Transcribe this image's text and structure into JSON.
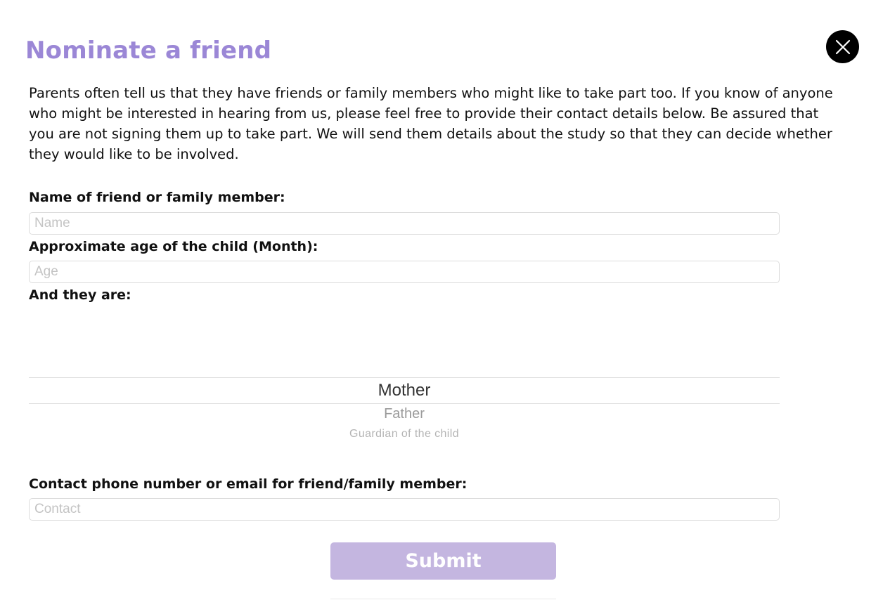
{
  "title": "Nominate a friend",
  "intro": "Parents often tell us that they have friends or family members who might like to take part too. If you know of anyone who might be interested in hearing from us, please feel free to provide their contact details below. Be assured that you are not signing them up to take part. We will send them details about the study so that they can decide whether they would like to be involved.",
  "name_field": {
    "label": "Name of friend or family member:",
    "placeholder": "Name",
    "value": ""
  },
  "age_field": {
    "label": "Approximate age of the child (Month):",
    "placeholder": "Age",
    "value": ""
  },
  "relation_picker": {
    "label": "And they are:",
    "selected": "Mother",
    "options": [
      "Mother",
      "Father",
      "Guardian of the child"
    ]
  },
  "contact_field": {
    "label": "Contact phone number or email for friend/family member:",
    "placeholder": "Contact",
    "value": ""
  },
  "submit_label": "Submit",
  "icons": {
    "close": "close-icon"
  },
  "colors": {
    "title": "#9b87d6",
    "submit_bg": "#c4b6e0",
    "close_bg": "#000000"
  }
}
